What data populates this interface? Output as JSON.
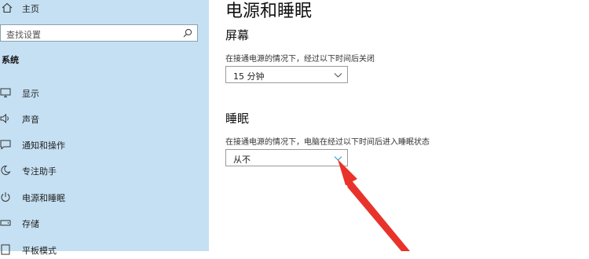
{
  "sidebar": {
    "home_label": "主页",
    "search_placeholder": "查找设置",
    "section_title": "系统",
    "items": [
      {
        "label": "显示",
        "icon": "monitor-icon"
      },
      {
        "label": "声音",
        "icon": "speaker-icon"
      },
      {
        "label": "通知和操作",
        "icon": "notification-icon"
      },
      {
        "label": "专注助手",
        "icon": "moon-icon"
      },
      {
        "label": "电源和睡眠",
        "icon": "power-icon"
      },
      {
        "label": "存储",
        "icon": "storage-icon"
      },
      {
        "label": "平板模式",
        "icon": "tablet-icon"
      }
    ]
  },
  "main": {
    "title": "电源和睡眠",
    "screen": {
      "heading": "屏幕",
      "description": "在接通电源的情况下，经过以下时间后关闭",
      "value": "15 分钟"
    },
    "sleep": {
      "heading": "睡眠",
      "description": "在接通电源的情况下，电脑在经过以下时间后进入睡眠状态",
      "value": "从不"
    }
  },
  "colors": {
    "sidebar_bg": "#c5e0f3",
    "annotation_arrow": "#e8332b",
    "focus_chevron": "#3aa0d8"
  }
}
